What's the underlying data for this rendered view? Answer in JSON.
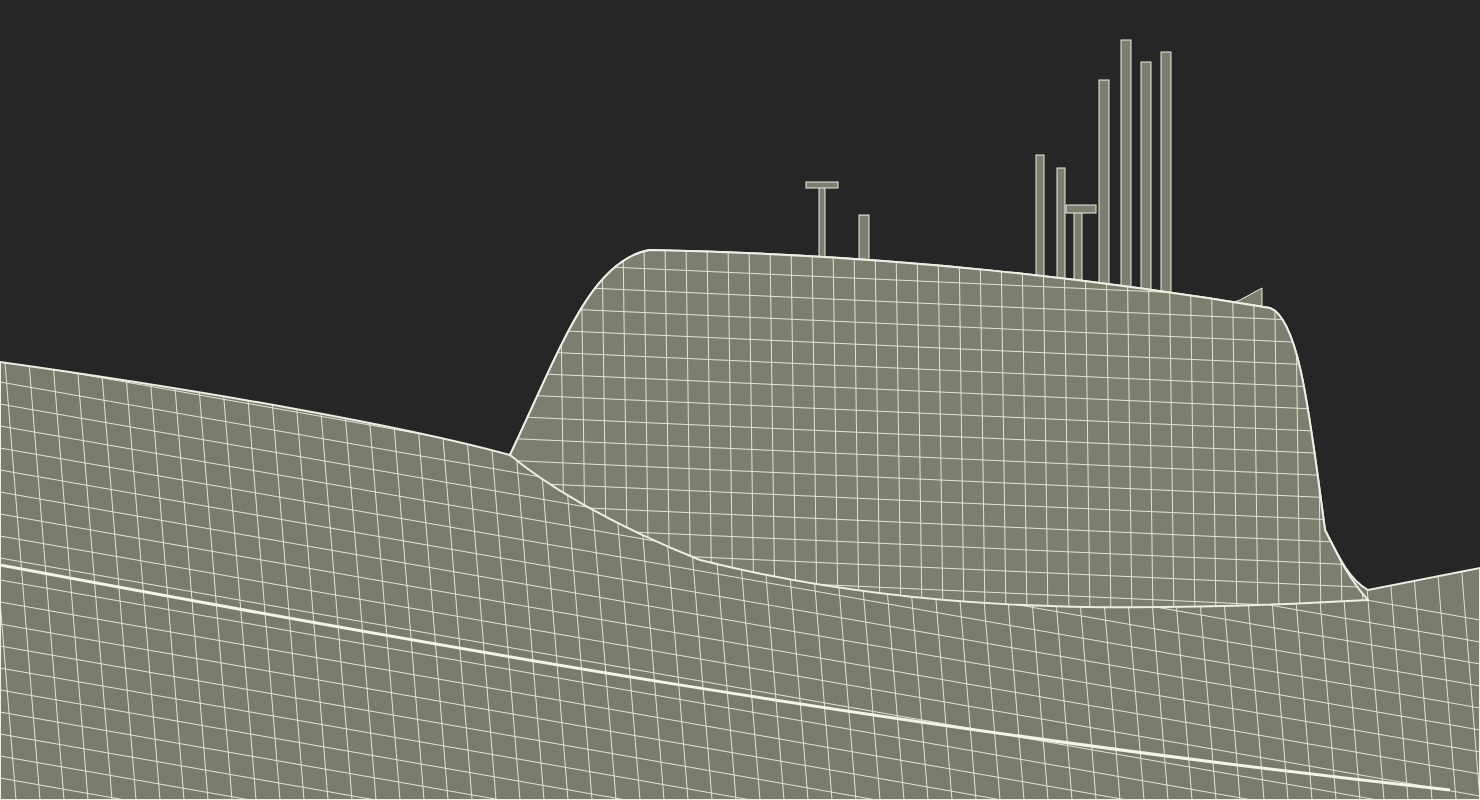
{
  "render": {
    "kind": "wireframe"
  }
}
